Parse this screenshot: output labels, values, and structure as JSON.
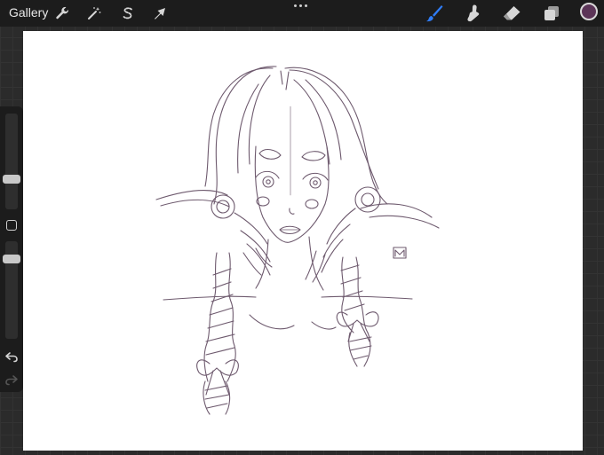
{
  "toolbar": {
    "gallery_label": "Gallery",
    "left_tools": [
      "wrench-icon",
      "magic-wand-icon",
      "selection-s-icon",
      "transform-arrow-icon"
    ],
    "right_tools": [
      "brush-icon",
      "smudge-icon",
      "eraser-icon",
      "layers-icon"
    ],
    "active_tool": "brush-icon",
    "accent_color": "#2f7cf6",
    "current_color": "#5c3558"
  },
  "sidebar": {
    "brush_size_level": 0.3,
    "opacity_level": 0.85
  },
  "canvas": {
    "background": "#ffffff",
    "ink_color": "#6e5a6e",
    "signature_mark": "M"
  }
}
